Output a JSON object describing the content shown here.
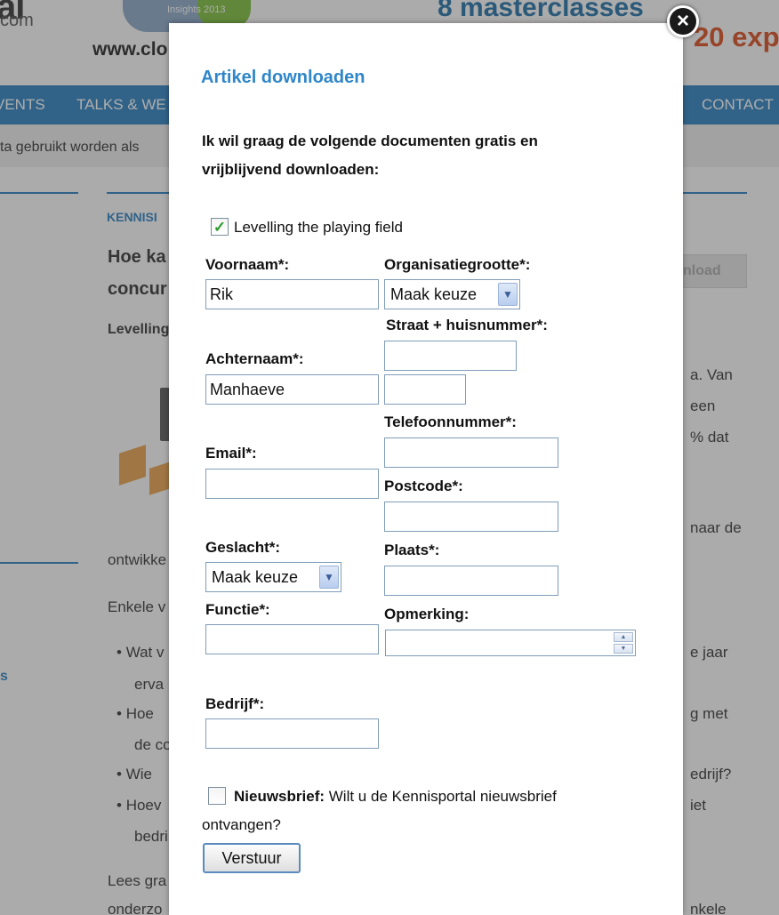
{
  "background": {
    "logo_text": "al",
    "logo_com": "com",
    "logo_bubble_text": "Insights 2013",
    "site_url": "www.clo",
    "banner_masterclasses": "8 masterclasses",
    "banner_expo": "20 exp",
    "nav": {
      "item_1": "VENTS",
      "item_2": "TALKS & WE",
      "item_3": "CONTACT"
    },
    "notice_text": "ta gebruikt worden als",
    "breadcrumb_label": "KENNISI",
    "article_title_line1": "Hoe ka",
    "article_title_line2": "concur",
    "article_subtitle": "Levelling",
    "download_button": "nload",
    "text_right_1": "a. Van",
    "text_right_2": "een",
    "text_right_3": "% dat",
    "text_right_4": "naar de",
    "text_left_1": "ontwikke",
    "text_left_2": "Enkele v",
    "bullets_left": [
      "Wat v",
      "erva",
      "Hoe",
      "de co",
      "Wie",
      "Hoev",
      "bedri"
    ],
    "bullets_right": [
      "e jaar",
      "g met",
      "edrijf?",
      "iet"
    ],
    "side_link": "s",
    "text_left_3": "Lees gra",
    "text_left_4": "onderzo",
    "text_right_5": "nkele"
  },
  "modal": {
    "title": "Artikel downloaden",
    "intro": "Ik wil graag de volgende documenten gratis en vrijblijvend downloaden:",
    "document_checkbox": {
      "label": "Levelling the playing field",
      "checked": true
    },
    "fields": {
      "voornaam": {
        "label": "Voornaam*:",
        "value": "Rik"
      },
      "achternaam": {
        "label": "Achternaam*:",
        "value": "Manhaeve"
      },
      "email": {
        "label": "Email*:",
        "value": ""
      },
      "geslacht": {
        "label": "Geslacht*:",
        "selected": "Maak keuze"
      },
      "functie": {
        "label": "Functie*:",
        "value": ""
      },
      "bedrijf": {
        "label": "Bedrijf*:",
        "value": ""
      },
      "organisatiegrootte": {
        "label": "Organisatiegrootte*:",
        "selected": "Maak keuze"
      },
      "straat": {
        "label": "Straat + huisnummer*:",
        "value": ""
      },
      "huisnummer": {
        "value": ""
      },
      "telefoonnummer": {
        "label": "Telefoonnummer*:",
        "value": ""
      },
      "postcode": {
        "label": "Postcode*:",
        "value": ""
      },
      "plaats": {
        "label": "Plaats*:",
        "value": ""
      },
      "opmerking": {
        "label": "Opmerking:",
        "value": ""
      }
    },
    "newsletter": {
      "label_bold": "Nieuwsbrief:",
      "label_rest": "Wilt u de Kennisportal nieuwsbrief",
      "label_line2": "ontvangen?",
      "checked": false
    },
    "submit_label": "Verstuur",
    "close_icon": "close-icon",
    "spin_up_icon": "up-arrow-icon",
    "spin_down_icon": "down-arrow-icon",
    "select_arrow_icon": "chevron-down-icon",
    "check_icon": "checkmark-icon"
  },
  "colors": {
    "accent": "#2f86c8",
    "nav_blue": "#2a7fc0",
    "expo_orange": "#d94a1c"
  }
}
